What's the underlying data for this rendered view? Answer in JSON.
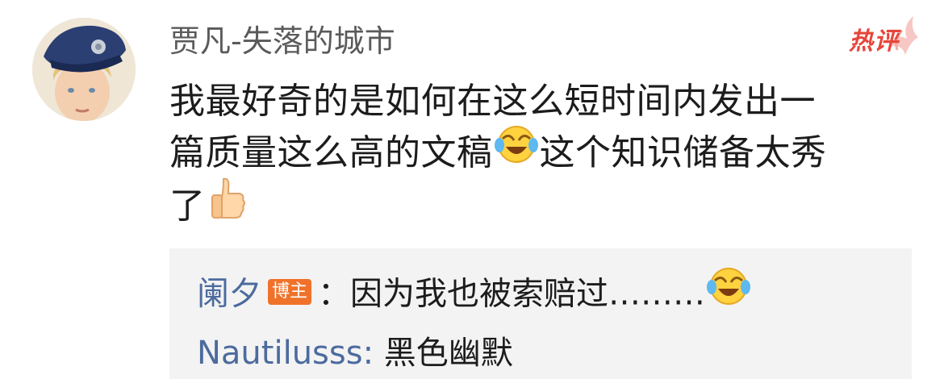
{
  "comment": {
    "author": "贾凡-失落的城市",
    "badge": "热评",
    "text_line1": "我最好奇的是如何在这么短时间内发出一",
    "text_line2a": "篇质量这么高的文稿",
    "text_line2b": "这个知识储备太秀",
    "text_line3": "了",
    "avatar_icon": "avatar-boy-police-cap",
    "emoji_1": "laugh-crying-emoji",
    "emoji_2": "thumbs-up-emoji"
  },
  "replies": [
    {
      "name": "阑夕",
      "tag": "博主",
      "separator": "：",
      "text": "因为我也被索赔过………",
      "emoji": "laugh-crying-emoji"
    },
    {
      "name": "Nautilusss",
      "separator": ": ",
      "text": "黑色幽默"
    }
  ],
  "colors": {
    "name": "#5a5a5a",
    "reply_name": "#4c6b9e",
    "badge": "#e8453a",
    "blogger_tag": "#f0722a",
    "reply_bg": "#f3f3f3"
  }
}
